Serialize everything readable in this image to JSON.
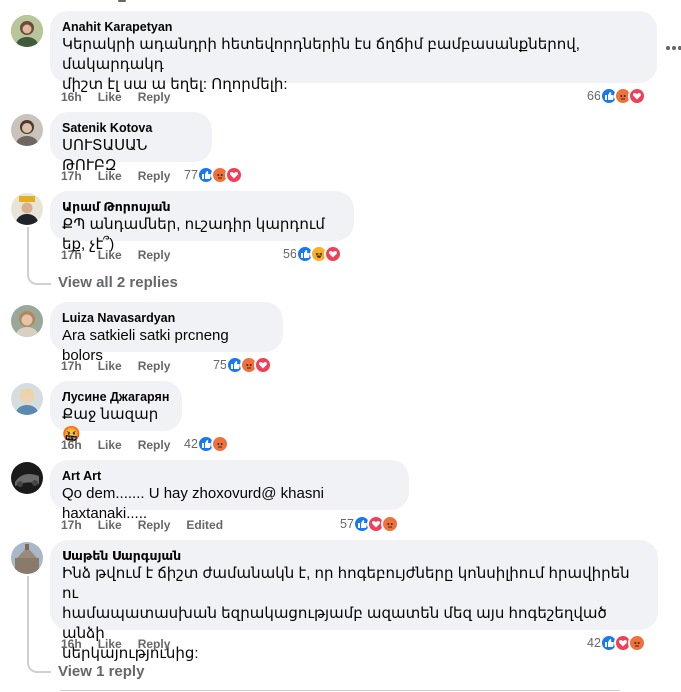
{
  "comments": [
    {
      "author": "Anahit Karapetyan",
      "text_lines": [
        "Կերակրի ադանդրի հետեվորդներին էս ճղճիմ բամբասանքներով, մակարդակդ",
        "միշտ էլ սա ա եղել: Ողորմելի:"
      ],
      "time": "16h",
      "like": "Like",
      "reply": "Reply",
      "reaction_count": "66",
      "reactions": [
        "like-icon",
        "angry-icon",
        "love-icon"
      ]
    },
    {
      "author": "Satenik Kotova",
      "text_lines": [
        "ՍՈՒՏԱՍԱՆ ԹՈՒԲԶ"
      ],
      "time": "17h",
      "like": "Like",
      "reply": "Reply",
      "reaction_count": "77",
      "reactions": [
        "like-icon",
        "angry-icon",
        "love-icon"
      ]
    },
    {
      "author": "Արամ Թորոսյան",
      "text_lines": [
        "ՔՊ անդամներ, ուշադիր կարդում եք, չէ՞)"
      ],
      "time": "17h",
      "like": "Like",
      "reply": "Reply",
      "reaction_count": "56",
      "reactions": [
        "like-icon",
        "haha-icon",
        "love-icon"
      ],
      "replies_label": "View all 2 replies"
    },
    {
      "author": "Luiza Navasardyan",
      "text_lines": [
        "Ara satkieli satki prcneng bolors"
      ],
      "time": "17h",
      "like": "Like",
      "reply": "Reply",
      "reaction_count": "75",
      "reactions": [
        "like-icon",
        "angry-icon",
        "love-icon"
      ]
    },
    {
      "author": "Лусине Джагарян",
      "text_lines": [
        "Քաջ նազար 🤬"
      ],
      "time": "16h",
      "like": "Like",
      "reply": "Reply",
      "reaction_count": "42",
      "reactions": [
        "like-icon",
        "angry-icon"
      ]
    },
    {
      "author": "Art Art",
      "text_lines": [
        "Qo dem....... U hay zhoxovurd@ khasni haxtanaki....."
      ],
      "time": "17h",
      "like": "Like",
      "reply": "Reply",
      "edited": "Edited",
      "reaction_count": "57",
      "reactions": [
        "like-icon",
        "love-icon",
        "angry-icon"
      ]
    },
    {
      "author": "Սաթեն Սարգսյան",
      "text_lines": [
        "Ինձ թվում է ճիշտ ժամանակն է, որ հոգեբույժները կոնսիլիում հրավիրեն ու",
        "համապատասխան եզրակացությամբ ազատեն մեզ այս հոգեշեղված անձի",
        "ներկայությունից:"
      ],
      "time": "16h",
      "like": "Like",
      "reply": "Reply",
      "reaction_count": "42",
      "reactions": [
        "like-icon",
        "love-icon",
        "angry-icon"
      ],
      "replies_label": "View 1 reply"
    }
  ],
  "colors": {
    "bubble": "#f0f2f5",
    "secondary_text": "#65676b",
    "like": "#1877f2",
    "love": "#f33e58",
    "angry": "#f0703b",
    "haha": "#f7b125"
  }
}
